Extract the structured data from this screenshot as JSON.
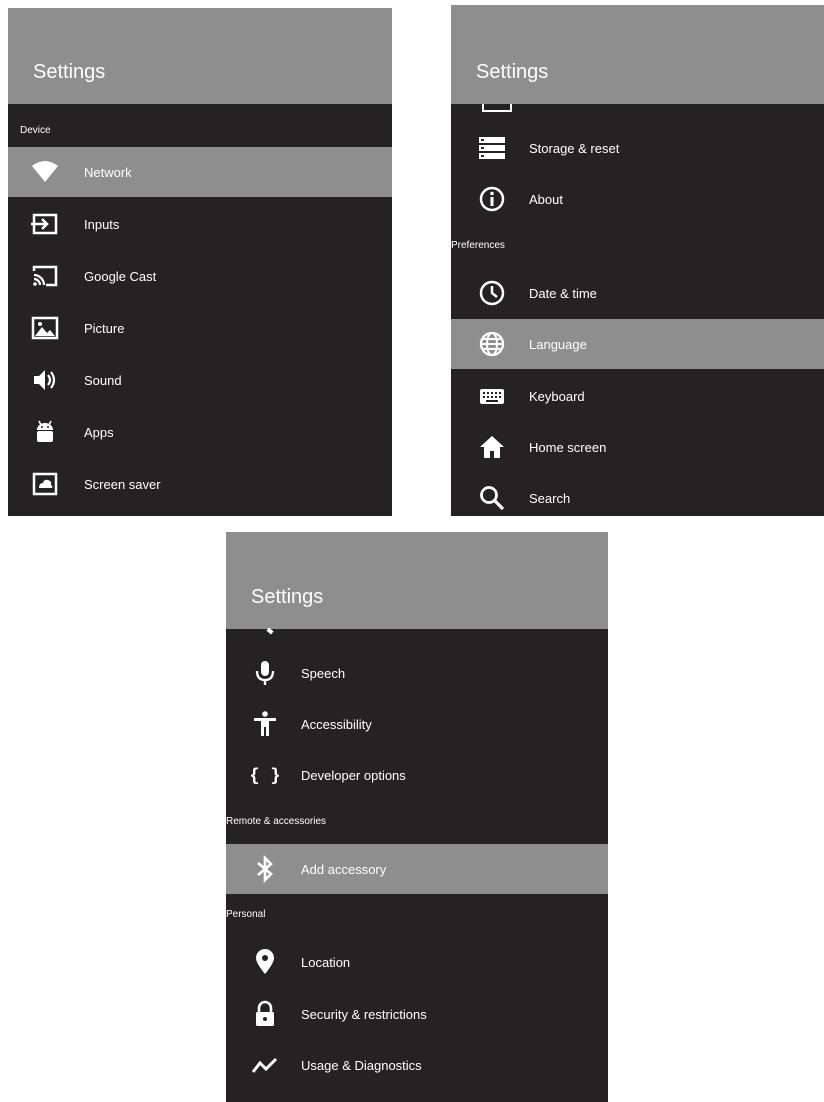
{
  "panel1": {
    "title": "Settings",
    "section_device": "Device",
    "items": [
      {
        "label": "Network",
        "icon": "wifi-icon"
      },
      {
        "label": "Inputs",
        "icon": "input-icon"
      },
      {
        "label": "Google Cast",
        "icon": "cast-icon"
      },
      {
        "label": "Picture",
        "icon": "picture-icon"
      },
      {
        "label": "Sound",
        "icon": "speaker-icon"
      },
      {
        "label": "Apps",
        "icon": "android-icon"
      },
      {
        "label": "Screen saver",
        "icon": "screensaver-icon"
      }
    ],
    "selected": "Network"
  },
  "panel2": {
    "title": "Settings",
    "section_preferences": "Preferences",
    "items": [
      {
        "label": "Storage & reset",
        "icon": "storage-icon"
      },
      {
        "label": "About",
        "icon": "info-icon"
      },
      {
        "label": "Date & time",
        "icon": "clock-icon"
      },
      {
        "label": "Language",
        "icon": "globe-icon"
      },
      {
        "label": "Keyboard",
        "icon": "keyboard-icon"
      },
      {
        "label": "Home screen",
        "icon": "home-icon"
      },
      {
        "label": "Search",
        "icon": "search-icon"
      }
    ],
    "selected": "Language"
  },
  "panel3": {
    "title": "Settings",
    "section_remote": "Remote & accessories",
    "section_personal": "Personal",
    "items": [
      {
        "label": "Speech",
        "icon": "microphone-icon"
      },
      {
        "label": "Accessibility",
        "icon": "accessibility-icon"
      },
      {
        "label": "Developer options",
        "icon": "braces-icon"
      },
      {
        "label": "Add accessory",
        "icon": "bluetooth-icon"
      },
      {
        "label": "Location",
        "icon": "location-pin-icon"
      },
      {
        "label": "Security & restrictions",
        "icon": "lock-icon"
      },
      {
        "label": "Usage & Diagnostics",
        "icon": "diagnostics-icon"
      }
    ],
    "selected": "Add accessory"
  },
  "colors": {
    "header": "#8e8e8e",
    "list_background": "#252223",
    "selected": "#8e8e8e",
    "text": "#ffffff"
  }
}
